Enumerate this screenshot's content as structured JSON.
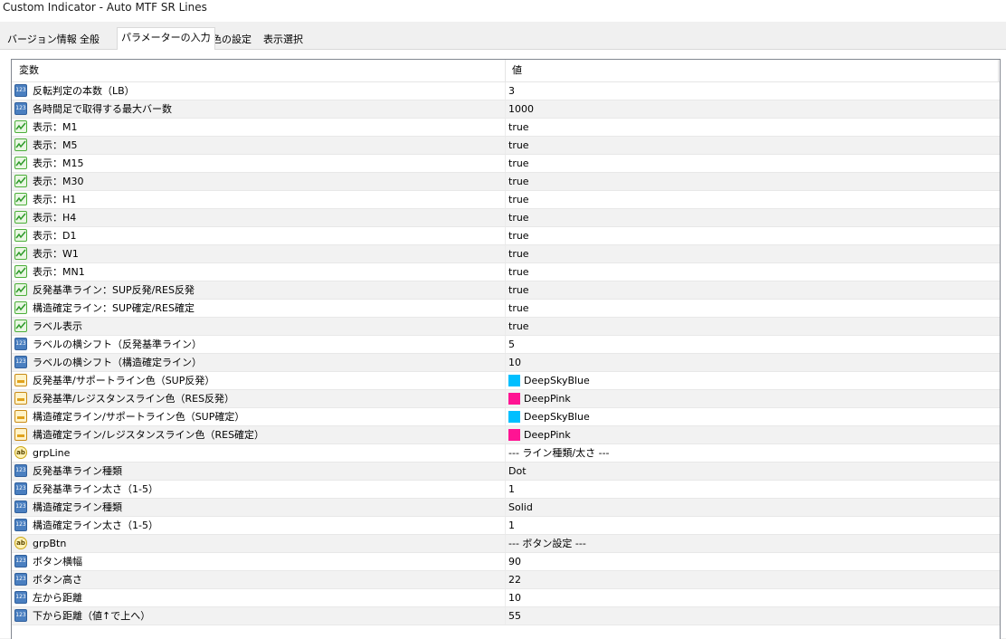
{
  "window": {
    "title": "Custom Indicator - Auto MTF SR Lines"
  },
  "tabs": [
    {
      "label": "バージョン情報"
    },
    {
      "label": "全般"
    },
    {
      "label": "パラメーターの入力"
    },
    {
      "label": "色の設定"
    },
    {
      "label": "表示選択"
    }
  ],
  "active_tab": "パラメーターの入力",
  "grid": {
    "columns": {
      "name": "変数",
      "value": "値"
    },
    "rows": [
      {
        "icon": "number-icon",
        "name": "反転判定の本数（LB）",
        "value": "3"
      },
      {
        "icon": "number-icon",
        "name": "各時間足で取得する最大バー数",
        "value": "1000"
      },
      {
        "icon": "bool-icon",
        "name": "表示：M1",
        "value": "true"
      },
      {
        "icon": "bool-icon",
        "name": "表示：M5",
        "value": "true"
      },
      {
        "icon": "bool-icon",
        "name": "表示：M15",
        "value": "true"
      },
      {
        "icon": "bool-icon",
        "name": "表示：M30",
        "value": "true"
      },
      {
        "icon": "bool-icon",
        "name": "表示：H1",
        "value": "true"
      },
      {
        "icon": "bool-icon",
        "name": "表示：H4",
        "value": "true"
      },
      {
        "icon": "bool-icon",
        "name": "表示：D1",
        "value": "true"
      },
      {
        "icon": "bool-icon",
        "name": "表示：W1",
        "value": "true"
      },
      {
        "icon": "bool-icon",
        "name": "表示：MN1",
        "value": "true"
      },
      {
        "icon": "bool-icon",
        "name": "反発基準ライン：SUP反発/RES反発",
        "value": "true"
      },
      {
        "icon": "bool-icon",
        "name": "構造確定ライン：SUP確定/RES確定",
        "value": "true"
      },
      {
        "icon": "bool-icon",
        "name": "ラベル表示",
        "value": "true"
      },
      {
        "icon": "number-icon",
        "name": "ラベルの横シフト（反発基準ライン）",
        "value": "5"
      },
      {
        "icon": "number-icon",
        "name": "ラベルの横シフト（構造確定ライン）",
        "value": "10"
      },
      {
        "icon": "color-icon",
        "name": "反発基準/サポートライン色（SUP反発）",
        "value": "DeepSkyBlue",
        "swatch": "#00bfff"
      },
      {
        "icon": "color-icon",
        "name": "反発基準/レジスタンスライン色（RES反発）",
        "value": "DeepPink",
        "swatch": "#ff1493"
      },
      {
        "icon": "color-icon",
        "name": "構造確定ライン/サポートライン色（SUP確定）",
        "value": "DeepSkyBlue",
        "swatch": "#00bfff"
      },
      {
        "icon": "color-icon",
        "name": "構造確定ライン/レジスタンスライン色（RES確定）",
        "value": "DeepPink",
        "swatch": "#ff1493"
      },
      {
        "icon": "string-icon",
        "name": "grpLine",
        "value": "--- ライン種類/太さ ---"
      },
      {
        "icon": "number-icon",
        "name": "反発基準ライン種類",
        "value": "Dot"
      },
      {
        "icon": "number-icon",
        "name": "反発基準ライン太さ（1-5）",
        "value": "1"
      },
      {
        "icon": "number-icon",
        "name": "構造確定ライン種類",
        "value": "Solid"
      },
      {
        "icon": "number-icon",
        "name": "構造確定ライン太さ（1-5）",
        "value": "1"
      },
      {
        "icon": "string-icon",
        "name": "grpBtn",
        "value": "--- ボタン設定 ---"
      },
      {
        "icon": "number-icon",
        "name": "ボタン横幅",
        "value": "90"
      },
      {
        "icon": "number-icon",
        "name": "ボタン高さ",
        "value": "22"
      },
      {
        "icon": "number-icon",
        "name": "左から距離",
        "value": "10"
      },
      {
        "icon": "number-icon",
        "name": "下から距離（値↑で上へ）",
        "value": "55"
      }
    ]
  }
}
